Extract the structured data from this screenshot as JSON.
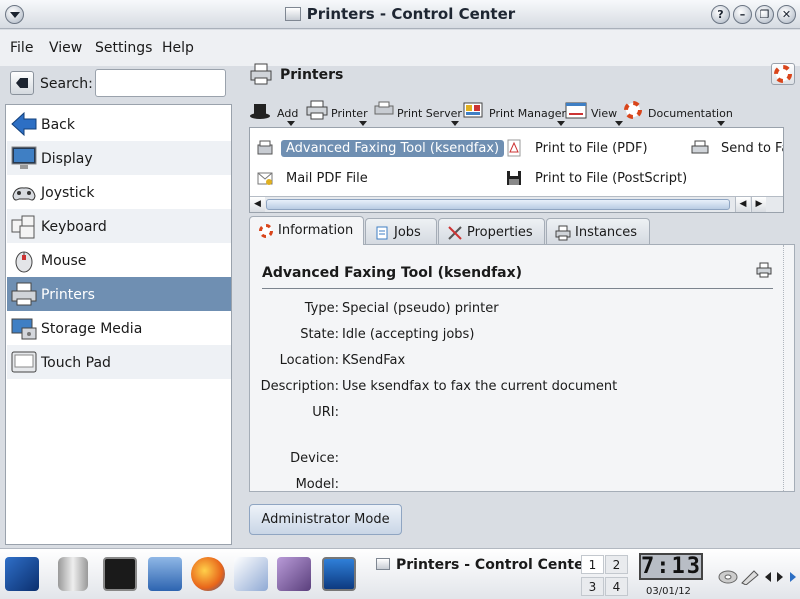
{
  "window": {
    "title": "Printers - Control Center"
  },
  "window_buttons": [
    "?",
    "–",
    "❐",
    "✕"
  ],
  "menubar": {
    "items": [
      "File",
      "View",
      "Settings",
      "Help"
    ]
  },
  "search": {
    "label": "Search:",
    "value": "",
    "placeholder": ""
  },
  "sidebar": {
    "items": [
      {
        "label": "Back",
        "icon": "back-arrow-icon"
      },
      {
        "label": "Display",
        "icon": "monitor-icon"
      },
      {
        "label": "Joystick",
        "icon": "joystick-icon"
      },
      {
        "label": "Keyboard",
        "icon": "keyboard-icon"
      },
      {
        "label": "Mouse",
        "icon": "mouse-icon"
      },
      {
        "label": "Printers",
        "icon": "printer-icon",
        "selected": true
      },
      {
        "label": "Storage Media",
        "icon": "storage-icon"
      },
      {
        "label": "Touch Pad",
        "icon": "touchpad-icon"
      }
    ]
  },
  "panel": {
    "title": "Printers"
  },
  "toolbar": {
    "items": [
      {
        "label": "Add",
        "icon": "wizard-hat-icon"
      },
      {
        "label": "Printer",
        "icon": "printer-icon"
      },
      {
        "label": "Print Server",
        "icon": "print-server-icon"
      },
      {
        "label": "Print Manager",
        "icon": "print-manager-icon"
      },
      {
        "label": "View",
        "icon": "view-icon"
      },
      {
        "label": "Documentation",
        "icon": "lifebuoy-icon"
      }
    ]
  },
  "printers": [
    {
      "label": "Advanced Faxing Tool (ksendfax)",
      "icon": "fax-icon",
      "selected": true
    },
    {
      "label": "Print to File (PDF)",
      "icon": "pdf-icon"
    },
    {
      "label": "Send to Fa",
      "icon": "printer-icon"
    },
    {
      "label": "Mail PDF File",
      "icon": "mail-icon"
    },
    {
      "label": "Print to File (PostScript)",
      "icon": "save-icon"
    }
  ],
  "tabs": [
    {
      "label": "Information",
      "icon": "lifebuoy-icon",
      "active": true
    },
    {
      "label": "Jobs",
      "icon": "jobs-icon"
    },
    {
      "label": "Properties",
      "icon": "tools-icon"
    },
    {
      "label": "Instances",
      "icon": "printer-icon"
    }
  ],
  "info": {
    "title": "Advanced Faxing Tool (ksendfax)",
    "rows": [
      {
        "key": "Type:",
        "value": "Special (pseudo) printer"
      },
      {
        "key": "State:",
        "value": "Idle (accepting jobs)"
      },
      {
        "key": "Location:",
        "value": "KSendFax"
      },
      {
        "key": "Description:",
        "value": "Use ksendfax to fax the current document"
      },
      {
        "key": "URI:",
        "value": ""
      },
      {
        "key": "Device:",
        "value": ""
      },
      {
        "key": "Model:",
        "value": ""
      }
    ]
  },
  "admin_button": {
    "label": "Administrator Mode"
  },
  "taskbar": {
    "task_title": "Printers - Control Center",
    "desktops": [
      "1",
      "2",
      "3",
      "4"
    ],
    "active_desktop": "1",
    "clock": "7:13",
    "date": "03/01/12"
  },
  "colors": {
    "selection": "#6f8fb2",
    "window_bg": "#eef0f3"
  }
}
